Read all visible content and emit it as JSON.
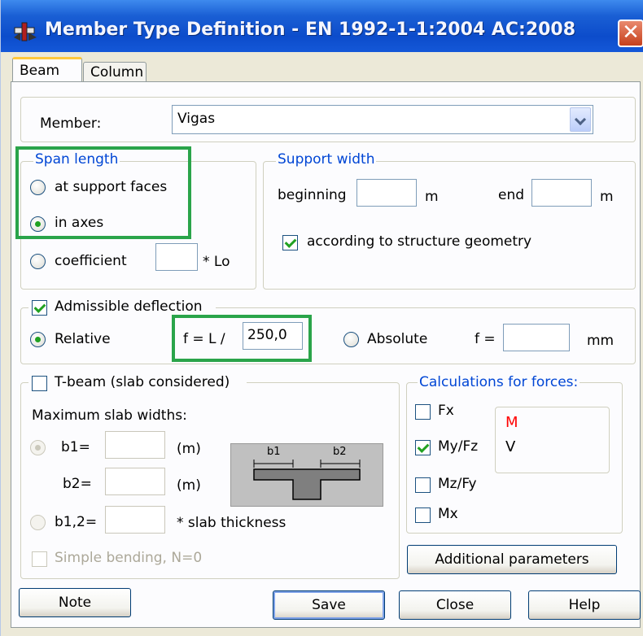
{
  "window": {
    "title": "Member Type Definition - EN 1992-1-1:2004 AC:2008",
    "close_symbol": "✕"
  },
  "tabs": [
    {
      "label": "Beam"
    },
    {
      "label": "Column"
    }
  ],
  "member": {
    "label": "Member:",
    "value": "Vigas"
  },
  "span_length": {
    "title": "Span length",
    "options": {
      "support_faces": "at support faces",
      "axes": "in axes",
      "coefficient": "coefficient"
    },
    "selected": "axes",
    "coefficient_value": "",
    "coefficient_unit": "* Lo"
  },
  "support_width": {
    "title": "Support width",
    "beginning_label": "beginning",
    "beginning_value": "",
    "beginning_unit": "m",
    "end_label": "end",
    "end_value": "",
    "end_unit": "m",
    "geometry_label": "according to structure geometry",
    "geometry_checked": true
  },
  "deflection": {
    "title": "Admissible deflection",
    "checked": true,
    "relative_label": "Relative",
    "formula_label": "f = L /",
    "relative_value": "250,0",
    "absolute_label": "Absolute",
    "f_label": "f =",
    "absolute_value": "",
    "unit": "mm",
    "selected": "relative"
  },
  "tbeam": {
    "title": "T-beam (slab considered)",
    "checked": false,
    "max_widths_label": "Maximum slab widths:",
    "b1_label": "b1=",
    "b2_label": "b2=",
    "unit_m": "(m)",
    "b12_label": "b1,2=",
    "slab_thickness": "* slab thickness",
    "simple_bending": "Simple bending, N=0",
    "diagram_b1": "b1",
    "diagram_b2": "b2"
  },
  "forces": {
    "title": "Calculations for forces:",
    "items": [
      {
        "label": "Fx",
        "checked": false
      },
      {
        "label": "My/Fz",
        "checked": true
      },
      {
        "label": "Mz/Fy",
        "checked": false
      },
      {
        "label": "Mx",
        "checked": false
      }
    ],
    "legend_m": "M",
    "legend_v": "V",
    "colors": {
      "m": "#ff0000",
      "v": "#000000"
    }
  },
  "buttons": {
    "additional": "Additional parameters",
    "note": "Note",
    "save": "Save",
    "close": "Close",
    "help": "Help"
  },
  "colors": {
    "accent": "#0046d5",
    "highlight": "#2aa44a",
    "check_mark": "#21a121",
    "titlebar": "#0c4ccb"
  }
}
